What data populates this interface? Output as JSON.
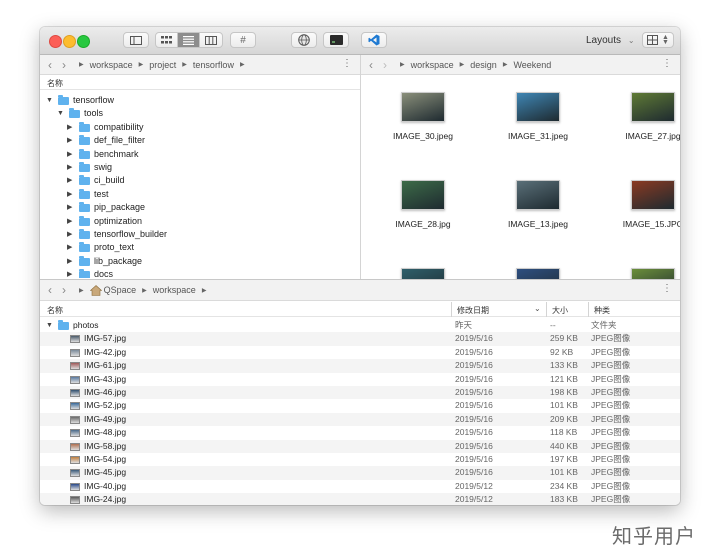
{
  "toolbar": {
    "layouts_label": "Layouts",
    "hash_label": "#"
  },
  "left_pane": {
    "path": [
      "workspace",
      "project",
      "tensorflow"
    ],
    "name_header": "名称",
    "tree": [
      {
        "label": "tensorflow",
        "level": 0,
        "expanded": true
      },
      {
        "label": "tools",
        "level": 1,
        "expanded": true
      },
      {
        "label": "compatibility",
        "level": 2,
        "expanded": false
      },
      {
        "label": "def_file_filter",
        "level": 2,
        "expanded": false
      },
      {
        "label": "benchmark",
        "level": 2,
        "expanded": false
      },
      {
        "label": "swig",
        "level": 2,
        "expanded": false
      },
      {
        "label": "ci_build",
        "level": 2,
        "expanded": false
      },
      {
        "label": "test",
        "level": 2,
        "expanded": false
      },
      {
        "label": "pip_package",
        "level": 2,
        "expanded": false
      },
      {
        "label": "optimization",
        "level": 2,
        "expanded": false
      },
      {
        "label": "tensorflow_builder",
        "level": 2,
        "expanded": false
      },
      {
        "label": "proto_text",
        "level": 2,
        "expanded": false
      },
      {
        "label": "lib_package",
        "level": 2,
        "expanded": false
      },
      {
        "label": "docs",
        "level": 2,
        "expanded": false
      }
    ]
  },
  "right_pane": {
    "path": [
      "workspace",
      "design",
      "Weekend"
    ],
    "thumbnails": [
      {
        "name": "IMAGE_30.jpeg",
        "color": "#8a8f7a"
      },
      {
        "name": "IMAGE_31.jpeg",
        "color": "#3f86b4"
      },
      {
        "name": "IMAGE_27.jpg",
        "color": "#5f7a35"
      },
      {
        "name": "IMAGE_28.jpg",
        "color": "#3d6b48"
      },
      {
        "name": "IMAGE_13.jpeg",
        "color": "#5a6f78"
      },
      {
        "name": "IMAGE_15.JPG",
        "color": "#8a3a22"
      },
      {
        "name": "",
        "color": "#2f5f6a"
      },
      {
        "name": "",
        "color": "#2e4f80"
      },
      {
        "name": "",
        "color": "#6b8f3a"
      }
    ]
  },
  "bottom_pane": {
    "path": [
      "QSpace",
      "workspace"
    ],
    "headers": {
      "name": "名称",
      "date": "修改日期",
      "size": "大小",
      "kind": "种类"
    },
    "folder": {
      "name": "photos",
      "date": "昨天",
      "size": "--",
      "kind": "文件夹"
    },
    "files": [
      {
        "name": "IMG-57.jpg",
        "date": "2019/5/16",
        "size": "259 KB",
        "kind": "JPEG图像",
        "color": "#4a5a6a"
      },
      {
        "name": "IMG-42.jpg",
        "date": "2019/5/16",
        "size": "92 KB",
        "kind": "JPEG图像",
        "color": "#7a8a9a"
      },
      {
        "name": "IMG-61.jpg",
        "date": "2019/5/16",
        "size": "133 KB",
        "kind": "JPEG图像",
        "color": "#a05a5a"
      },
      {
        "name": "IMG-43.jpg",
        "date": "2019/5/16",
        "size": "121 KB",
        "kind": "JPEG图像",
        "color": "#5a7aa0"
      },
      {
        "name": "IMG-46.jpg",
        "date": "2019/5/16",
        "size": "198 KB",
        "kind": "JPEG图像",
        "color": "#2f4f6f"
      },
      {
        "name": "IMG-52.jpg",
        "date": "2019/5/16",
        "size": "101 KB",
        "kind": "JPEG图像",
        "color": "#3a6a9a"
      },
      {
        "name": "IMG-49.jpg",
        "date": "2019/5/16",
        "size": "209 KB",
        "kind": "JPEG图像",
        "color": "#6a6a6a"
      },
      {
        "name": "IMG-48.jpg",
        "date": "2019/5/16",
        "size": "118 KB",
        "kind": "JPEG图像",
        "color": "#4a6a8a"
      },
      {
        "name": "IMG-58.jpg",
        "date": "2019/5/16",
        "size": "440 KB",
        "kind": "JPEG图像",
        "color": "#b07050"
      },
      {
        "name": "IMG-54.jpg",
        "date": "2019/5/16",
        "size": "197 KB",
        "kind": "JPEG图像",
        "color": "#c08040"
      },
      {
        "name": "IMG-45.jpg",
        "date": "2019/5/16",
        "size": "101 KB",
        "kind": "JPEG图像",
        "color": "#3a5a7a"
      },
      {
        "name": "IMG-40.jpg",
        "date": "2019/5/12",
        "size": "234 KB",
        "kind": "JPEG图像",
        "color": "#2a4a8a"
      },
      {
        "name": "IMG-24.jpg",
        "date": "2019/5/12",
        "size": "183 KB",
        "kind": "JPEG图像",
        "color": "#5a5a5a"
      }
    ]
  },
  "watermark": "知乎用户"
}
